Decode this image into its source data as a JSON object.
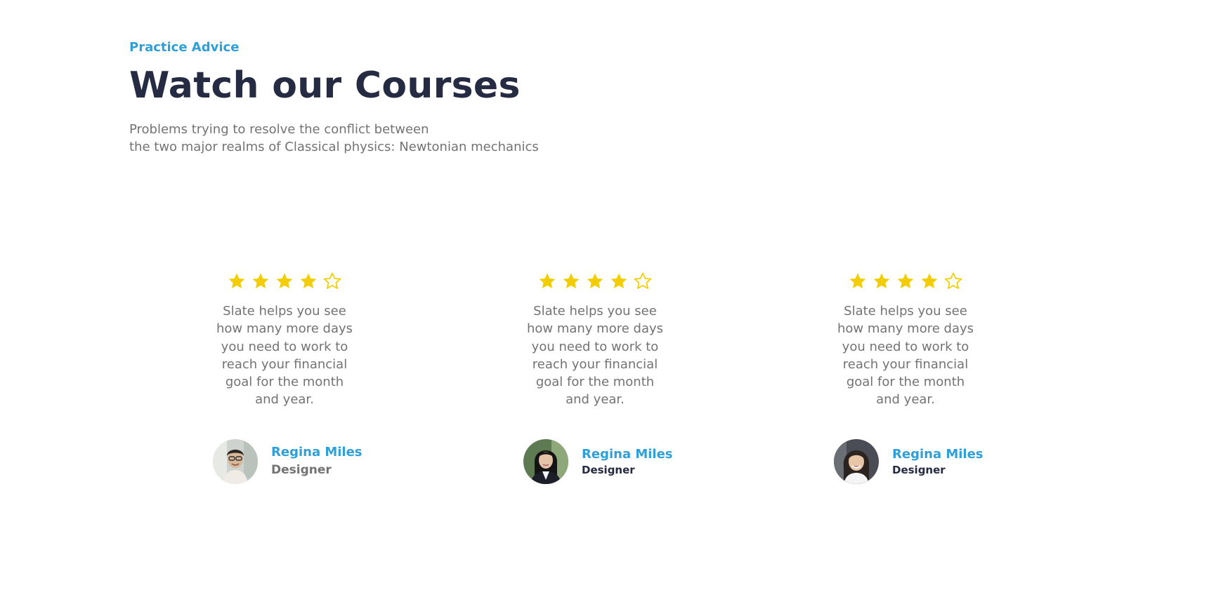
{
  "header": {
    "eyebrow": "Practice Advice",
    "title": "Watch our Courses",
    "intro_line1": "Problems trying to resolve the conflict between",
    "intro_line2": "the two major realms of Classical physics: Newtonian mechanics"
  },
  "colors": {
    "accent": "#2f9fd8",
    "heading": "#252b42",
    "muted": "#737373",
    "star": "#f3cd03"
  },
  "testimonials": [
    {
      "rating": 4,
      "max_rating": 5,
      "quote": "Slate helps you see how many more days you need to work to reach your financial goal for the month and year.",
      "name": "Regina Miles",
      "role": "Designer",
      "avatar_icon": "avatar-man-photo"
    },
    {
      "rating": 4,
      "max_rating": 5,
      "quote": "Slate helps you see how many more days you need to work to reach your financial goal for the month and year.",
      "name": "Regina Miles",
      "role": "Designer",
      "avatar_icon": "avatar-woman-photo"
    },
    {
      "rating": 4,
      "max_rating": 5,
      "quote": "Slate helps you see how many more days you need to work to reach your financial goal for the month and year.",
      "name": "Regina Miles",
      "role": "Designer",
      "avatar_icon": "avatar-woman-photo"
    }
  ]
}
